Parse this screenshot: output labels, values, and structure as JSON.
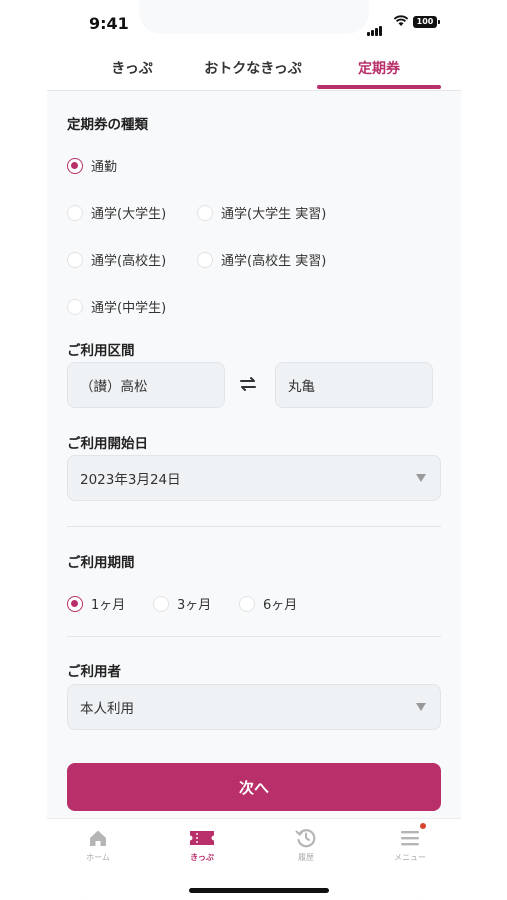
{
  "status_bar": {
    "time": "9:41",
    "battery": "100"
  },
  "tabs": [
    {
      "label": "きっぷ",
      "active": false
    },
    {
      "label": "おトクなきっぷ",
      "active": false
    },
    {
      "label": "定期券",
      "active": true
    }
  ],
  "pass_type": {
    "title": "定期券の種類",
    "options": [
      {
        "label": "通勤",
        "checked": true
      },
      {
        "label": "通学(大学生)",
        "checked": false
      },
      {
        "label": "通学(大学生 実習)",
        "checked": false
      },
      {
        "label": "通学(高校生)",
        "checked": false
      },
      {
        "label": "通学(高校生 実習)",
        "checked": false
      },
      {
        "label": "通学(中学生)",
        "checked": false
      }
    ]
  },
  "route": {
    "title": "ご利用区間",
    "from": "（讃）高松",
    "to": "丸亀",
    "swap_icon": "swap-icon"
  },
  "start_date": {
    "title": "ご利用開始日",
    "value": "2023年3月24日"
  },
  "period": {
    "title": "ご利用期間",
    "options": [
      {
        "label": "1ヶ月",
        "checked": true
      },
      {
        "label": "3ヶ月",
        "checked": false
      },
      {
        "label": "6ヶ月",
        "checked": false
      }
    ]
  },
  "user": {
    "title": "ご利用者",
    "value": "本人利用"
  },
  "next_button": {
    "label": "次へ"
  },
  "bottom_nav": [
    {
      "label": "ホーム",
      "icon": "home-icon",
      "active": false
    },
    {
      "label": "きっぷ",
      "icon": "ticket-icon",
      "active": true
    },
    {
      "label": "履歴",
      "icon": "history-icon",
      "active": false
    },
    {
      "label": "メニュー",
      "icon": "menu-icon",
      "active": false
    }
  ],
  "colors": {
    "accent": "#b82f6a",
    "background": "#f8f9fa"
  }
}
